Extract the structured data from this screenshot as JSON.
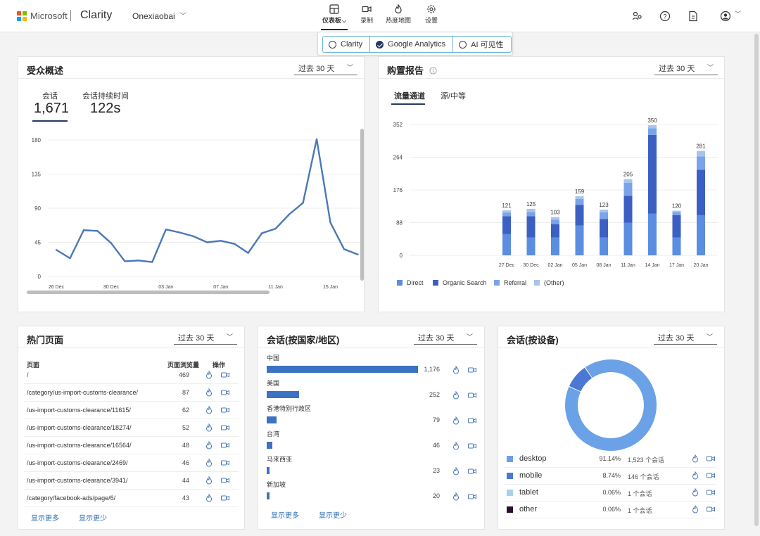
{
  "header": {
    "ms_name": "Microsoft",
    "brand": "Clarity",
    "project": "Onexiaobai",
    "nav": [
      {
        "label": "仪表板",
        "icon": "dashboard-icon",
        "active": true
      },
      {
        "label": "录制",
        "icon": "video-camera-icon",
        "active": false
      },
      {
        "label": "热度地图",
        "icon": "flame-icon",
        "active": false
      },
      {
        "label": "设置",
        "icon": "gear-icon",
        "active": false
      }
    ],
    "dashboard_chevron": "⌵"
  },
  "source_toggle": {
    "options": [
      "Clarity",
      "Google Analytics",
      "AI 可见性"
    ],
    "selected": "Google Analytics"
  },
  "audience": {
    "title": "受众概述",
    "range": "过去 30 天",
    "sessions_label": "会话",
    "sessions_value": "1,671",
    "duration_label": "会话持续时间",
    "duration_value": "122s",
    "y_ticks": [
      "180",
      "135",
      "90",
      "45",
      "0"
    ],
    "x_ticks": [
      "26 Dec",
      "30 Dec",
      "03 Jan",
      "07 Jan",
      "11 Jan",
      "15 Jan"
    ]
  },
  "attribution": {
    "title": "购置报告",
    "range": "过去 30 天",
    "tabs": [
      "流量通道",
      "源/中等"
    ],
    "legend": [
      "Direct",
      "Organic Search",
      "Referral",
      "(Other)"
    ]
  },
  "chart_data": [
    {
      "type": "line",
      "title": "",
      "xlabel": "",
      "ylabel": "",
      "ylim": [
        0,
        180
      ],
      "y_ticks": [
        0,
        45,
        90,
        135,
        180
      ],
      "x_tick_labels": [
        "26 Dec",
        "30 Dec",
        "03 Jan",
        "07 Jan",
        "11 Jan",
        "15 Jan"
      ],
      "grid": true,
      "series": [
        {
          "name": "会话",
          "color": "#4a78b8",
          "values": [
            35,
            24,
            61,
            60,
            44,
            20,
            21,
            19,
            62,
            58,
            53,
            45,
            47,
            43,
            31,
            57,
            63,
            82,
            97,
            181,
            71,
            36,
            29
          ]
        }
      ]
    },
    {
      "type": "bar",
      "stacked": true,
      "title": "",
      "ylim": [
        0,
        352
      ],
      "y_ticks": [
        0,
        88,
        176,
        264,
        352
      ],
      "grid": true,
      "legend_position": "bottom-left",
      "categories": [
        "27 Dec",
        "30 Dec",
        "02 Jan",
        "05 Jan",
        "08 Jan",
        "11 Jan",
        "14 Jan",
        "17 Jan",
        "20 Jan"
      ],
      "totals": [
        121,
        125,
        103,
        159,
        123,
        205,
        350,
        120,
        281
      ],
      "series": [
        {
          "name": "Direct",
          "color": "#5b8de0",
          "values": [
            57,
            48,
            48,
            80,
            48,
            88,
            112,
            48,
            108
          ]
        },
        {
          "name": "Organic Search",
          "color": "#3c5fc4",
          "values": [
            48,
            57,
            36,
            56,
            50,
            72,
            212,
            60,
            122
          ]
        },
        {
          "name": "Referral",
          "color": "#7aa4e8",
          "values": [
            10,
            12,
            12,
            16,
            18,
            35,
            18,
            8,
            36
          ]
        },
        {
          "name": "(Other)",
          "color": "#a9c3ee",
          "values": [
            6,
            8,
            7,
            7,
            7,
            10,
            8,
            4,
            15
          ]
        }
      ]
    },
    {
      "type": "bar",
      "orientation": "horizontal",
      "title": "会话(按国家/地区)",
      "categories": [
        "中国",
        "美国",
        "香港特别行政区",
        "台湾",
        "马来西亚",
        "新加坡"
      ],
      "values": [
        1176,
        252,
        79,
        46,
        23,
        20
      ]
    },
    {
      "type": "pie",
      "donut": true,
      "title": "会话(按设备)",
      "categories": [
        "desktop",
        "mobile",
        "tablet",
        "other"
      ],
      "values": [
        91.14,
        8.74,
        0.06,
        0.06
      ],
      "colors": [
        "#6ba1e6",
        "#4a78d4",
        "#a8d0ec",
        "#2a1030"
      ]
    }
  ],
  "top_pages": {
    "title": "热门页面",
    "range": "过去 30 天",
    "col_page": "页面",
    "col_views": "页面浏览量",
    "col_actions": "操作",
    "rows": [
      {
        "url": "/",
        "views": "469"
      },
      {
        "url": "/category/us-import-customs-clearance/",
        "views": "87"
      },
      {
        "url": "/us-import-customs-clearance/11615/",
        "views": "62"
      },
      {
        "url": "/us-import-customs-clearance/18274/",
        "views": "52"
      },
      {
        "url": "/us-import-customs-clearance/16564/",
        "views": "48"
      },
      {
        "url": "/us-import-customs-clearance/2469/",
        "views": "46"
      },
      {
        "url": "/us-import-customs-clearance/3941/",
        "views": "44"
      },
      {
        "url": "/category/facebook-ads/page/6/",
        "views": "43"
      }
    ],
    "show_more": "显示更多",
    "show_less": "显示更少"
  },
  "country": {
    "title": "会话(按国家/地区)",
    "range": "过去 30 天",
    "rows": [
      {
        "name": "中国",
        "value": "1,176"
      },
      {
        "name": "美国",
        "value": "252"
      },
      {
        "name": "香港特别行政区",
        "value": "79"
      },
      {
        "name": "台湾",
        "value": "46"
      },
      {
        "name": "马来西亚",
        "value": "23"
      },
      {
        "name": "新加坡",
        "value": "20"
      }
    ],
    "show_more": "显示更多",
    "show_less": "显示更少"
  },
  "device": {
    "title": "会话(按设备)",
    "range": "过去 30 天",
    "rows": [
      {
        "name": "desktop",
        "pct": "91.14%",
        "count": "1,523 个会话",
        "color": "#6ba1e6"
      },
      {
        "name": "mobile",
        "pct": "8.74%",
        "count": "146 个会话",
        "color": "#4a78d4"
      },
      {
        "name": "tablet",
        "pct": "0.06%",
        "count": "1 个会话",
        "color": "#a8d0ec"
      },
      {
        "name": "other",
        "pct": "0.06%",
        "count": "1 个会话",
        "color": "#2a1030"
      }
    ]
  }
}
